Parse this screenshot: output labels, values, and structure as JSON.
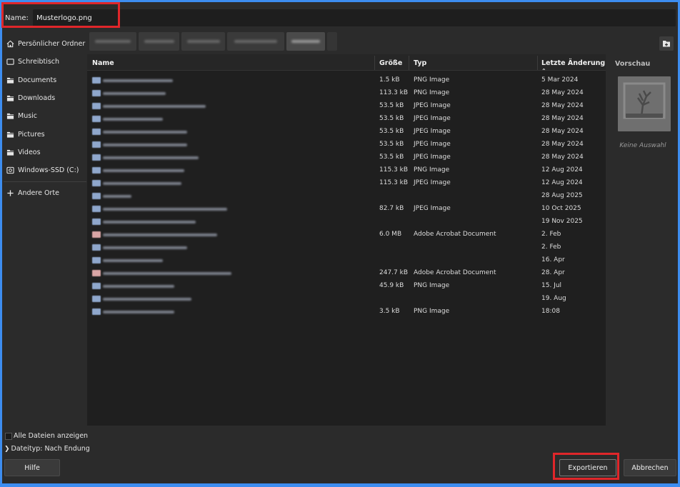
{
  "name_row": {
    "label": "Name:",
    "value": "Musterlogo.png"
  },
  "sidebar": {
    "items": [
      {
        "label": "Persönlicher Ordner",
        "icon": "home-icon"
      },
      {
        "label": "Schreibtisch",
        "icon": "desktop-icon"
      },
      {
        "label": "Documents",
        "icon": "folder-icon"
      },
      {
        "label": "Downloads",
        "icon": "folder-icon"
      },
      {
        "label": "Music",
        "icon": "folder-icon"
      },
      {
        "label": "Pictures",
        "icon": "folder-icon"
      },
      {
        "label": "Videos",
        "icon": "folder-icon"
      },
      {
        "label": "Windows-SSD (C:)",
        "icon": "drive-icon"
      }
    ],
    "other_places": {
      "label": "Andere Orte",
      "icon": "plus-icon"
    }
  },
  "columns": {
    "name": "Name",
    "size": "Größe",
    "type": "Typ",
    "modified": "Letzte Änderung",
    "preview": "Vorschau"
  },
  "files": [
    {
      "size": "1.5 kB",
      "type": "PNG Image",
      "modified": "5 Mar 2024",
      "icon": "image-icon"
    },
    {
      "size": "113.3 kB",
      "type": "PNG Image",
      "modified": "28 May 2024",
      "icon": "image-icon"
    },
    {
      "size": "53.5 kB",
      "type": "JPEG Image",
      "modified": "28 May 2024",
      "icon": "image-icon"
    },
    {
      "size": "53.5 kB",
      "type": "JPEG Image",
      "modified": "28 May 2024",
      "icon": "image-icon"
    },
    {
      "size": "53.5 kB",
      "type": "JPEG Image",
      "modified": "28 May 2024",
      "icon": "image-icon"
    },
    {
      "size": "53.5 kB",
      "type": "JPEG Image",
      "modified": "28 May 2024",
      "icon": "image-icon"
    },
    {
      "size": "53.5 kB",
      "type": "JPEG Image",
      "modified": "28 May 2024",
      "icon": "image-icon"
    },
    {
      "size": "115.3 kB",
      "type": "PNG Image",
      "modified": "12 Aug 2024",
      "icon": "image-icon"
    },
    {
      "size": "115.3 kB",
      "type": "JPEG Image",
      "modified": "12 Aug 2024",
      "icon": "image-icon"
    },
    {
      "size": "",
      "type": "",
      "modified": "28 Aug 2025",
      "icon": "folder-icon"
    },
    {
      "size": "82.7 kB",
      "type": "JPEG Image",
      "modified": "10 Oct 2025",
      "icon": "image-icon"
    },
    {
      "size": "",
      "type": "",
      "modified": "19 Nov 2025",
      "icon": "folder-icon"
    },
    {
      "size": "6.0 MB",
      "type": "Adobe Acrobat Document",
      "modified": "2. Feb",
      "icon": "pdf-icon"
    },
    {
      "size": "",
      "type": "",
      "modified": "2. Feb",
      "icon": "folder-icon"
    },
    {
      "size": "",
      "type": "",
      "modified": "16. Apr",
      "icon": "folder-icon"
    },
    {
      "size": "247.7 kB",
      "type": "Adobe Acrobat Document",
      "modified": "28. Apr",
      "icon": "pdf-icon"
    },
    {
      "size": "45.9 kB",
      "type": "PNG Image",
      "modified": "15. Jul",
      "icon": "image-icon"
    },
    {
      "size": "",
      "type": "",
      "modified": "19. Aug",
      "icon": "folder-icon"
    },
    {
      "size": "3.5 kB",
      "type": "PNG Image",
      "modified": "18:08",
      "icon": "image-icon"
    }
  ],
  "preview": {
    "empty_text": "Keine Auswahl"
  },
  "bottom": {
    "show_all_label": "Alle Dateien anzeigen",
    "filetype_label": "Dateityp: Nach Endung",
    "help_button": "Hilfe",
    "export_button": "Exportieren",
    "cancel_button": "Abbrechen"
  }
}
